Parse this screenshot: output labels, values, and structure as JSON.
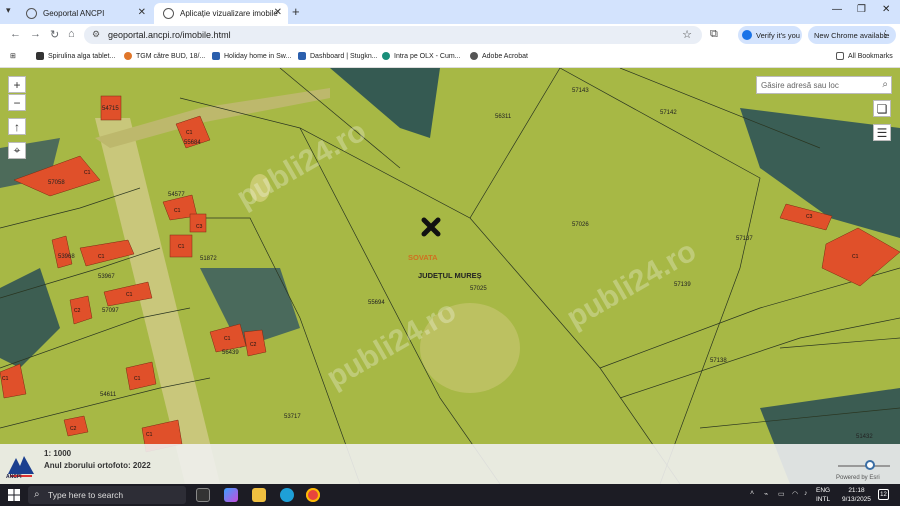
{
  "browser": {
    "tabs": [
      {
        "label": "Geoportal ANCPI",
        "icon": "globe-icon"
      },
      {
        "label": "Aplicație vizualizare imobile",
        "icon": "globe-icon"
      }
    ],
    "url": "geoportal.ancpi.ro/imobile.html",
    "verify_label": "Verify it's you",
    "new_chrome_label": "New Chrome available"
  },
  "bookmarks": {
    "items": [
      "Spirulina alga tablet...",
      "TGM către BUD, 18/...",
      "Holiday home in Sw...",
      "Dashboard | Stugkn...",
      "Intra pe OLX - Cum...",
      "Adobe Acrobat"
    ],
    "all_label": "All Bookmarks"
  },
  "map": {
    "search_placeholder": "Găsire adresă sau loc",
    "locality": "SOVATA",
    "county": "JUDEȚUL MUREȘ",
    "parcel_labels": [
      "54715",
      "55684",
      "57058",
      "54577",
      "51872",
      "53968",
      "53967",
      "57097",
      "56439",
      "54611",
      "53717",
      "55694",
      "57025",
      "56311",
      "57143",
      "57142",
      "57026",
      "57137",
      "57139",
      "57138",
      "51432"
    ],
    "scale": "1: 1000",
    "ortho_year": "Anul zborului ortofoto: 2022",
    "powered_by": "Powered by Esri",
    "logo_text": "ANCPI",
    "watermark": "publi24.ro"
  },
  "taskbar": {
    "search_placeholder": "Type here to search",
    "lang1": "ENG",
    "lang2": "INTL",
    "time": "21:18",
    "date": "9/13/2025",
    "notif_count": "12"
  }
}
